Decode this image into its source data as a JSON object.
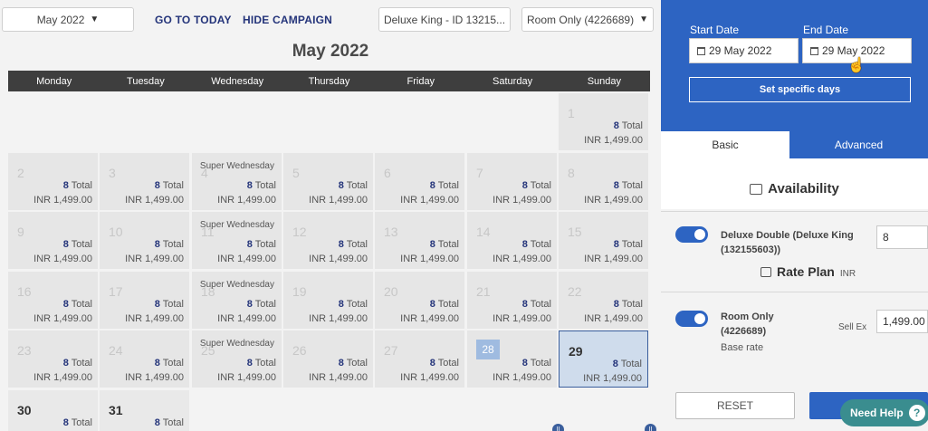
{
  "toolbar": {
    "month_select": "May 2022",
    "go_to_today": "GO TO TODAY",
    "hide_campaign": "HIDE CAMPAIGN",
    "room_select": "Deluxe King - ID 13215...",
    "plan_select": "Room Only (4226689)"
  },
  "calendar": {
    "title": "May 2022",
    "weekdays": [
      "Monday",
      "Tuesday",
      "Wednesday",
      "Thursday",
      "Friday",
      "Saturday",
      "Sunday"
    ],
    "total_suffix": "Total",
    "super_wednesday": "Super Wednesday",
    "days": [
      {
        "day": "1",
        "total": "8",
        "rate": "INR 1,499.00"
      },
      {
        "day": "2",
        "total": "8",
        "rate": "INR 1,499.00"
      },
      {
        "day": "3",
        "total": "8",
        "rate": "INR 1,499.00"
      },
      {
        "day": "4",
        "total": "8",
        "rate": "INR 1,499.00",
        "campaign": "Super Wednesday"
      },
      {
        "day": "5",
        "total": "8",
        "rate": "INR 1,499.00"
      },
      {
        "day": "6",
        "total": "8",
        "rate": "INR 1,499.00"
      },
      {
        "day": "7",
        "total": "8",
        "rate": "INR 1,499.00"
      },
      {
        "day": "8",
        "total": "8",
        "rate": "INR 1,499.00"
      },
      {
        "day": "9",
        "total": "8",
        "rate": "INR 1,499.00"
      },
      {
        "day": "10",
        "total": "8",
        "rate": "INR 1,499.00"
      },
      {
        "day": "11",
        "total": "8",
        "rate": "INR 1,499.00",
        "campaign": "Super Wednesday"
      },
      {
        "day": "12",
        "total": "8",
        "rate": "INR 1,499.00"
      },
      {
        "day": "13",
        "total": "8",
        "rate": "INR 1,499.00"
      },
      {
        "day": "14",
        "total": "8",
        "rate": "INR 1,499.00"
      },
      {
        "day": "15",
        "total": "8",
        "rate": "INR 1,499.00"
      },
      {
        "day": "16",
        "total": "8",
        "rate": "INR 1,499.00"
      },
      {
        "day": "17",
        "total": "8",
        "rate": "INR 1,499.00"
      },
      {
        "day": "18",
        "total": "8",
        "rate": "INR 1,499.00",
        "campaign": "Super Wednesday"
      },
      {
        "day": "19",
        "total": "8",
        "rate": "INR 1,499.00"
      },
      {
        "day": "20",
        "total": "8",
        "rate": "INR 1,499.00"
      },
      {
        "day": "21",
        "total": "8",
        "rate": "INR 1,499.00"
      },
      {
        "day": "22",
        "total": "8",
        "rate": "INR 1,499.00"
      },
      {
        "day": "23",
        "total": "8",
        "rate": "INR 1,499.00"
      },
      {
        "day": "24",
        "total": "8",
        "rate": "INR 1,499.00"
      },
      {
        "day": "25",
        "total": "8",
        "rate": "INR 1,499.00",
        "campaign": "Super Wednesday"
      },
      {
        "day": "26",
        "total": "8",
        "rate": "INR 1,499.00"
      },
      {
        "day": "27",
        "total": "8",
        "rate": "INR 1,499.00"
      },
      {
        "day": "28",
        "total": "8",
        "rate": "INR 1,499.00"
      },
      {
        "day": "29",
        "total": "8",
        "rate": "INR 1,499.00"
      },
      {
        "day": "30",
        "total": "8",
        "rate": ""
      },
      {
        "day": "31",
        "total": "8",
        "rate": ""
      }
    ]
  },
  "panel": {
    "start_date_label": "Start Date",
    "start_date_value": "29 May 2022",
    "end_date_label": "End Date",
    "end_date_value": "29 May 2022",
    "set_specific_days": "Set specific days",
    "tab_basic": "Basic",
    "tab_advanced": "Advanced",
    "availability_title": "Availability",
    "room_name": "Deluxe Double (Deluxe King",
    "room_id": "(132155603))",
    "room_count": "8",
    "rate_plan_title": "Rate Plan",
    "rate_plan_currency": "INR",
    "plan_name": "Room Only",
    "plan_id": "(4226689)",
    "plan_sub": "Base rate",
    "sell_ex_label": "Sell Ex",
    "sell_ex_value": "1,499.00",
    "reset_label": "RESET",
    "need_help": "Need Help",
    "help_q": "?"
  }
}
